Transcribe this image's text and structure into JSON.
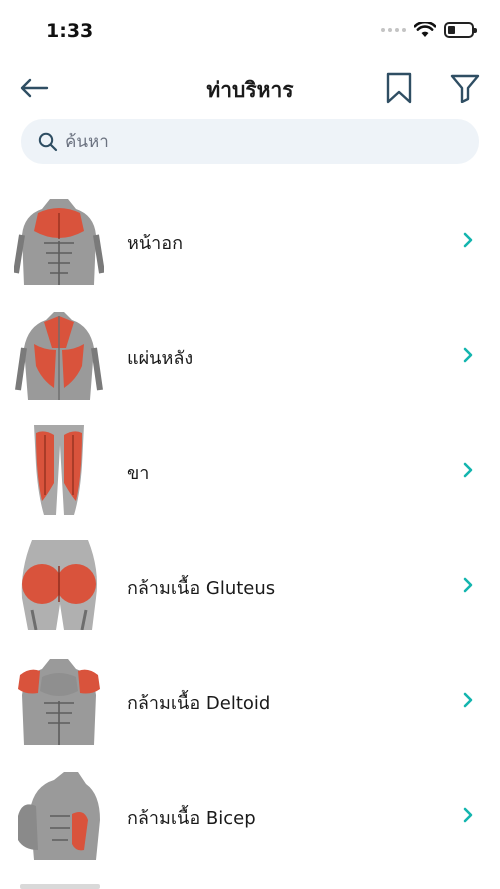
{
  "status": {
    "time": "1:33"
  },
  "header": {
    "title": "ท่าบริหาร",
    "back_icon": "arrow-left-icon",
    "bookmark_icon": "bookmark-icon",
    "filter_icon": "filter-icon"
  },
  "search": {
    "placeholder": "ค้นหา",
    "value": ""
  },
  "items": [
    {
      "label": "หน้าอก",
      "icon": "chest-muscle-image"
    },
    {
      "label": "แผ่นหลัง",
      "icon": "back-muscle-image"
    },
    {
      "label": "ขา",
      "icon": "legs-muscle-image"
    },
    {
      "label": "กล้ามเนื้อ Gluteus",
      "icon": "gluteus-muscle-image"
    },
    {
      "label": "กล้ามเนื้อ Deltoid",
      "icon": "deltoid-muscle-image"
    },
    {
      "label": "กล้ามเนื้อ Bicep",
      "icon": "bicep-muscle-image"
    }
  ],
  "colors": {
    "accent": "#13b5ae",
    "icon_dark": "#2f4e63",
    "muscle_highlight": "#d9533c",
    "search_bg": "#eef3f8"
  }
}
